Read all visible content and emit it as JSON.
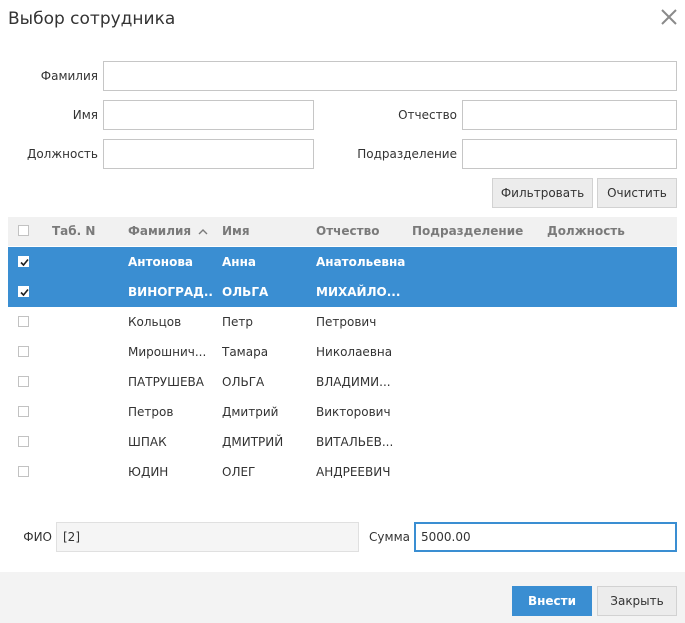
{
  "dialog": {
    "title": "Выбор сотрудника"
  },
  "filters": {
    "surname_label": "Фамилия",
    "surname_value": "",
    "name_label": "Имя",
    "name_value": "",
    "patronymic_label": "Отчество",
    "patronymic_value": "",
    "position_label": "Должность",
    "position_value": "",
    "department_label": "Подразделение",
    "department_value": "",
    "filter_button": "Фильтровать",
    "clear_button": "Очистить"
  },
  "table": {
    "columns": {
      "tab_n": "Таб. N",
      "surname": "Фамилия",
      "name": "Имя",
      "patronymic": "Отчество",
      "department": "Подразделение",
      "position": "Должность"
    },
    "sort_icon": "chevron-up-icon",
    "rows": [
      {
        "checked": true,
        "tab_n": "",
        "surname": "Антонова",
        "name": "Анна",
        "patronymic": "Анатольевна",
        "department": "",
        "position": ""
      },
      {
        "checked": true,
        "tab_n": "",
        "surname": "ВИНОГРАД...",
        "name": "ОЛЬГА",
        "patronymic": "МИХАЙЛО...",
        "department": "",
        "position": ""
      },
      {
        "checked": false,
        "tab_n": "",
        "surname": "Кольцов",
        "name": "Петр",
        "patronymic": "Петрович",
        "department": "",
        "position": ""
      },
      {
        "checked": false,
        "tab_n": "",
        "surname": "Мирошнич...",
        "name": "Тамара",
        "patronymic": "Николаевна",
        "department": "",
        "position": ""
      },
      {
        "checked": false,
        "tab_n": "",
        "surname": "ПАТРУШЕВА",
        "name": "ОЛЬГА",
        "patronymic": "ВЛАДИМИ...",
        "department": "",
        "position": ""
      },
      {
        "checked": false,
        "tab_n": "",
        "surname": "Петров",
        "name": "Дмитрий",
        "patronymic": "Викторович",
        "department": "",
        "position": ""
      },
      {
        "checked": false,
        "tab_n": "",
        "surname": "ШПАК",
        "name": "ДМИТРИЙ",
        "patronymic": "ВИТАЛЬЕВ...",
        "department": "",
        "position": ""
      },
      {
        "checked": false,
        "tab_n": "",
        "surname": "ЮДИН",
        "name": "ОЛЕГ",
        "patronymic": "АНДРЕЕВИЧ",
        "department": "",
        "position": ""
      }
    ]
  },
  "summary": {
    "fio_label": "ФИО",
    "fio_value": "[2]",
    "sum_label": "Сумма",
    "sum_value": "5000.00"
  },
  "footer": {
    "submit_button": "Внести",
    "close_button": "Закрыть"
  },
  "colors": {
    "accent": "#3a8ed2",
    "selected_row": "#3a8ed2",
    "header_bg": "#f1f1f1",
    "footer_bg": "#f3f3f3"
  }
}
